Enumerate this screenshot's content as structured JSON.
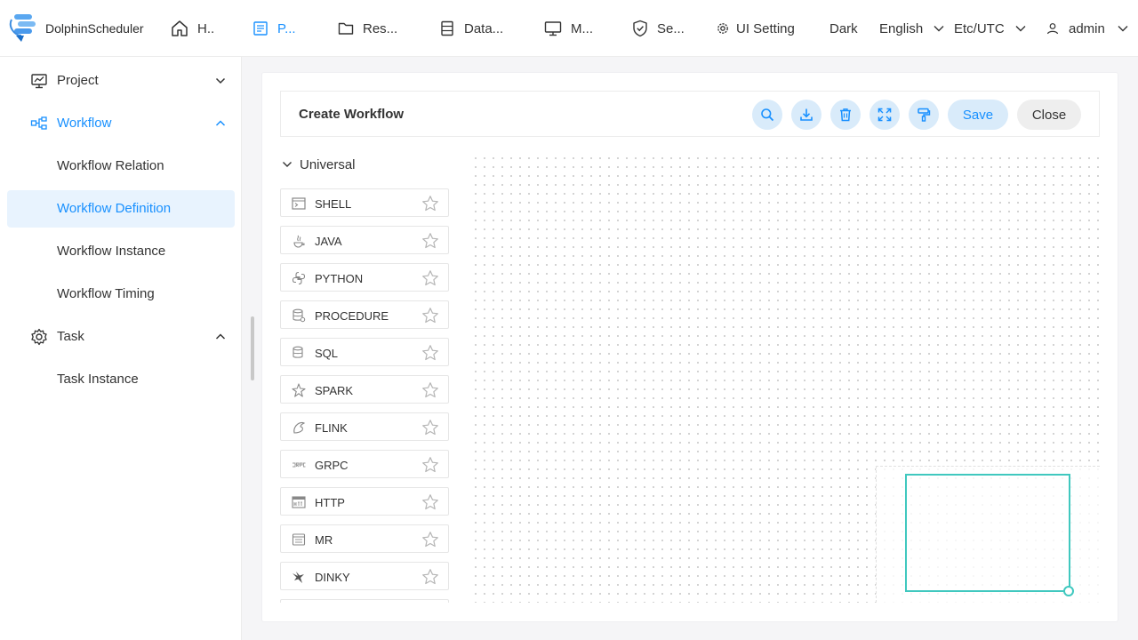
{
  "app": {
    "name": "DolphinScheduler"
  },
  "nav": {
    "items": [
      {
        "label": "H..",
        "icon": "home-icon"
      },
      {
        "label": "P...",
        "icon": "project-icon",
        "active": true
      },
      {
        "label": "Res...",
        "icon": "folder-icon"
      },
      {
        "label": "Data...",
        "icon": "database-icon"
      },
      {
        "label": "M...",
        "icon": "monitor-icon"
      },
      {
        "label": "Se...",
        "icon": "security-icon"
      },
      {
        "label": "UI Setting",
        "icon": "gear-icon"
      }
    ],
    "theme": "Dark",
    "language": "English",
    "timezone": "Etc/UTC",
    "user": "admin"
  },
  "sidebar": {
    "items": [
      {
        "label": "Project"
      },
      {
        "label": "Workflow"
      },
      {
        "label": "Workflow Relation"
      },
      {
        "label": "Workflow Definition",
        "selected": true
      },
      {
        "label": "Workflow Instance"
      },
      {
        "label": "Workflow Timing"
      },
      {
        "label": "Task"
      },
      {
        "label": "Task Instance"
      }
    ]
  },
  "toolbar": {
    "title": "Create Workflow",
    "save_label": "Save",
    "close_label": "Close"
  },
  "palette": {
    "group": "Universal",
    "tasks": [
      {
        "name": "SHELL",
        "icon": "shell-icon"
      },
      {
        "name": "JAVA",
        "icon": "java-icon"
      },
      {
        "name": "PYTHON",
        "icon": "python-icon"
      },
      {
        "name": "PROCEDURE",
        "icon": "procedure-icon"
      },
      {
        "name": "SQL",
        "icon": "sql-icon"
      },
      {
        "name": "SPARK",
        "icon": "spark-icon"
      },
      {
        "name": "FLINK",
        "icon": "flink-icon"
      },
      {
        "name": "GRPC",
        "icon": "grpc-icon"
      },
      {
        "name": "HTTP",
        "icon": "http-icon"
      },
      {
        "name": "MR",
        "icon": "mr-icon"
      },
      {
        "name": "DINKY",
        "icon": "dinky-icon"
      }
    ]
  },
  "colors": {
    "accent": "#1890ff",
    "accent_light": "#d9ebfa",
    "minimap": "#40c8bf"
  }
}
